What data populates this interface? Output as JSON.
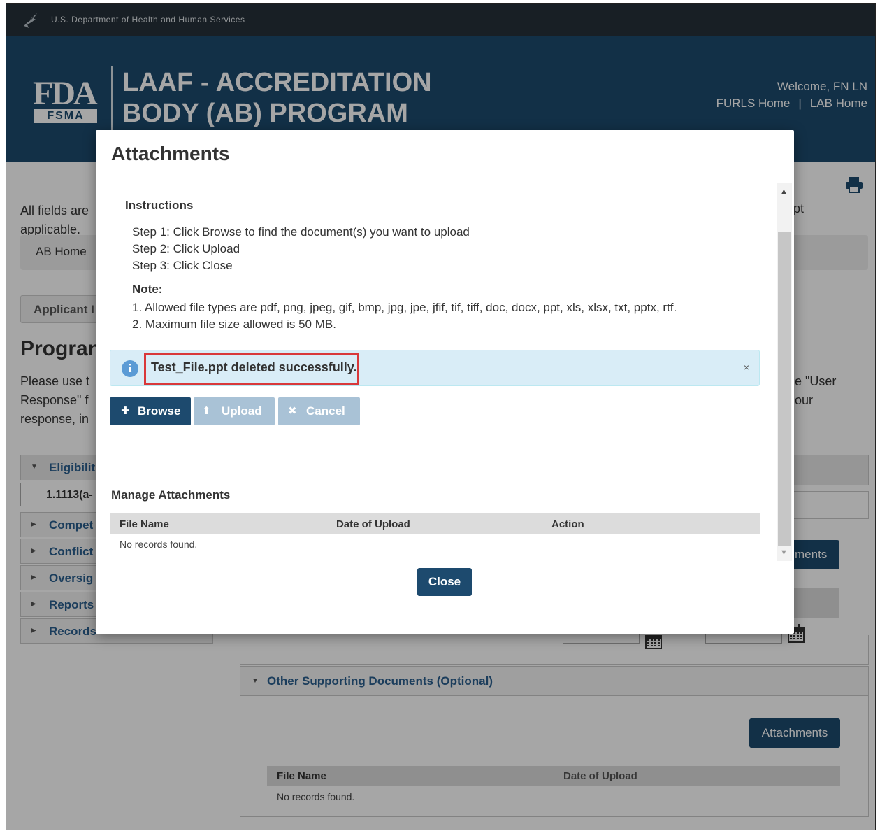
{
  "hhs_bar": {
    "text": "U.S. Department of Health and Human Services",
    "eagle_icon": "hhs-eagle-icon"
  },
  "header": {
    "logo_text": "FDA",
    "logo_badge": "FSMA",
    "title_line1": "LAAF - ACCREDITATION",
    "title_line2": "BODY (AB) PROGRAM",
    "welcome": "Welcome, FN LN",
    "link_furls": "FURLS Home",
    "link_separator": "|",
    "link_lab": "LAB Home"
  },
  "background": {
    "req_text_line1": "All fields are",
    "req_text_line2": "applicable.",
    "req_text_right": "pt",
    "breadcrumb": "AB Home",
    "tab_label": "Applicant I",
    "program_title": "Progran",
    "program_desc_line1": "Please use t",
    "program_desc_line2": "Response\" f",
    "program_desc_line3": "response, in",
    "program_desc_right1": "e \"User",
    "program_desc_right2": "our",
    "accordion": [
      {
        "label": "Eligibilit",
        "open": true
      },
      {
        "label": "Compet"
      },
      {
        "label": "Conflict"
      },
      {
        "label": "Oversig"
      },
      {
        "label": "Reports"
      },
      {
        "label": "Records"
      }
    ],
    "accordion_sub_item": "1.1113(a-",
    "right_button": "ments",
    "section": {
      "title": "Other Supporting Documents (Optional)",
      "attach_button": "Attachments",
      "col_file_name": "File Name",
      "col_date": "Date of Upload",
      "no_records": "No records found."
    }
  },
  "modal": {
    "title": "Attachments",
    "instructions_heading": "Instructions",
    "steps": [
      "Step 1: Click Browse to find the document(s) you want to upload",
      "Step 2: Click Upload",
      "Step 3: Click Close"
    ],
    "note_heading": "Note:",
    "notes": [
      "1. Allowed file types are pdf, png, jpeg, gif, bmp, jpg, jpe, jfif, tif, tiff, doc, docx, ppt, xls, xlsx, txt, pptx, rtf.",
      "2. Maximum file size allowed is 50 MB."
    ],
    "alert_message": "Test_File.ppt deleted successfully.",
    "alert_close": "×",
    "buttons": {
      "browse": "Browse",
      "upload": "Upload",
      "cancel": "Cancel",
      "close": "Close"
    },
    "manage_heading": "Manage Attachments",
    "table_columns": [
      "File Name",
      "Date of Upload",
      "Action"
    ],
    "no_records": "No records found."
  },
  "colors": {
    "header_bg": "#1d4a6e",
    "hhs_bar_bg": "#26313a",
    "alert_bg": "#d9edf7",
    "highlight_border": "#d9383a",
    "primary_button": "#1d4a6e",
    "disabled_button": "#a9c2d6"
  }
}
